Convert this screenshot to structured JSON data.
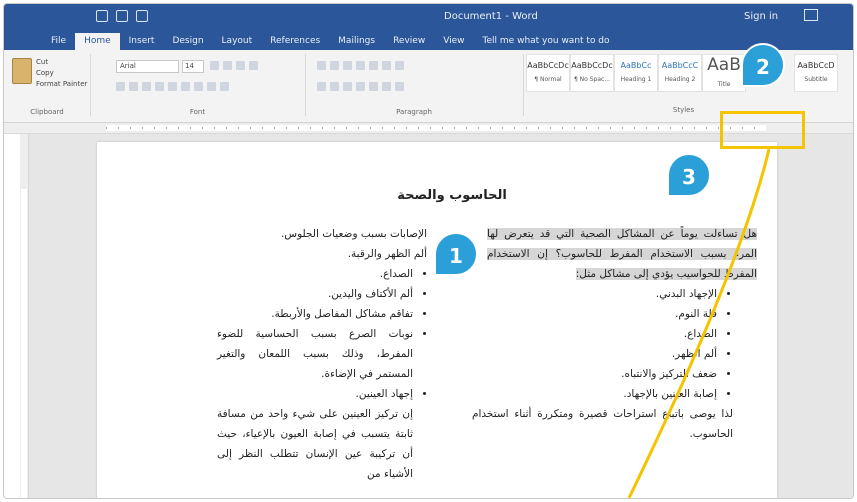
{
  "titlebar": {
    "document": "Document1 - Word",
    "signin": "Sign in"
  },
  "tabs": [
    "File",
    "Home",
    "Insert",
    "Design",
    "Layout",
    "References",
    "Mailings",
    "Review",
    "View",
    "Tell me what you want to do"
  ],
  "ribbon": {
    "clipboard": {
      "label": "Clipboard",
      "cut": "Cut",
      "copy": "Copy",
      "format_painter": "Format Painter"
    },
    "font": {
      "label": "Font",
      "name": "Arial",
      "size": "14"
    },
    "paragraph": {
      "label": "Paragraph"
    },
    "styles": {
      "label": "Styles",
      "items": [
        {
          "sample": "AaBbCcDc",
          "name": "¶ Normal"
        },
        {
          "sample": "AaBbCcDc",
          "name": "¶ No Spac..."
        },
        {
          "sample": "AaBbCc",
          "name": "Heading 1"
        },
        {
          "sample": "AaBbCcC",
          "name": "Heading 2"
        },
        {
          "sample": "AaB",
          "name": "Title"
        },
        {
          "sample": "AaBbCcD",
          "name": "Subtitle"
        }
      ]
    }
  },
  "document": {
    "title": "الحاسوب والصحة",
    "right_column": {
      "intro": "هل تساءلت يوماً عن المشاكل الصحية التي قد يتعرض لها المرء بسبب الاستخدام المفرط للحاسوب؟ إن الاستخدام المفرط للحواسيب يؤدي إلى مشاكل مثل:",
      "items": [
        "الإجهاد البدني.",
        "قلة النوم.",
        "الصداع.",
        "ألم الظهر.",
        "ضعف التركيز والانتباه.",
        "إصابة العينين بالإجهاد."
      ],
      "tail": "لذا يوصى باتباع استراحات قصيرة ومتكررة أثناء استخدام الحاسوب."
    },
    "left_column": {
      "intro": "الإصابات بسبب وضعيات الجلوس.",
      "line2": "ألم الظهر والرقبة.",
      "items": [
        "الصداع.",
        "ألم الأكتاف واليدين.",
        "تفاقم مشاكل المفاصل والأربطة.",
        "نوبات الصرع بسبب الحساسية للضوء المفرط، وذلك بسبب اللمعان والتغير المستمر في الإضاءة.",
        "إجهاد العينين."
      ],
      "para": "إن تركيز العينين على شيء واحد من مسافة ثابتة يتسبب في إصابة العيون بالإعياء، حيث أن تركيبة عين الإنسان تتطلب النظر إلى الأشياء من"
    }
  },
  "annotations": [
    "1",
    "2",
    "3"
  ],
  "colors": {
    "word_blue": "#2b579a",
    "badge": "#2a9fd8",
    "highlight": "#f5c400"
  }
}
